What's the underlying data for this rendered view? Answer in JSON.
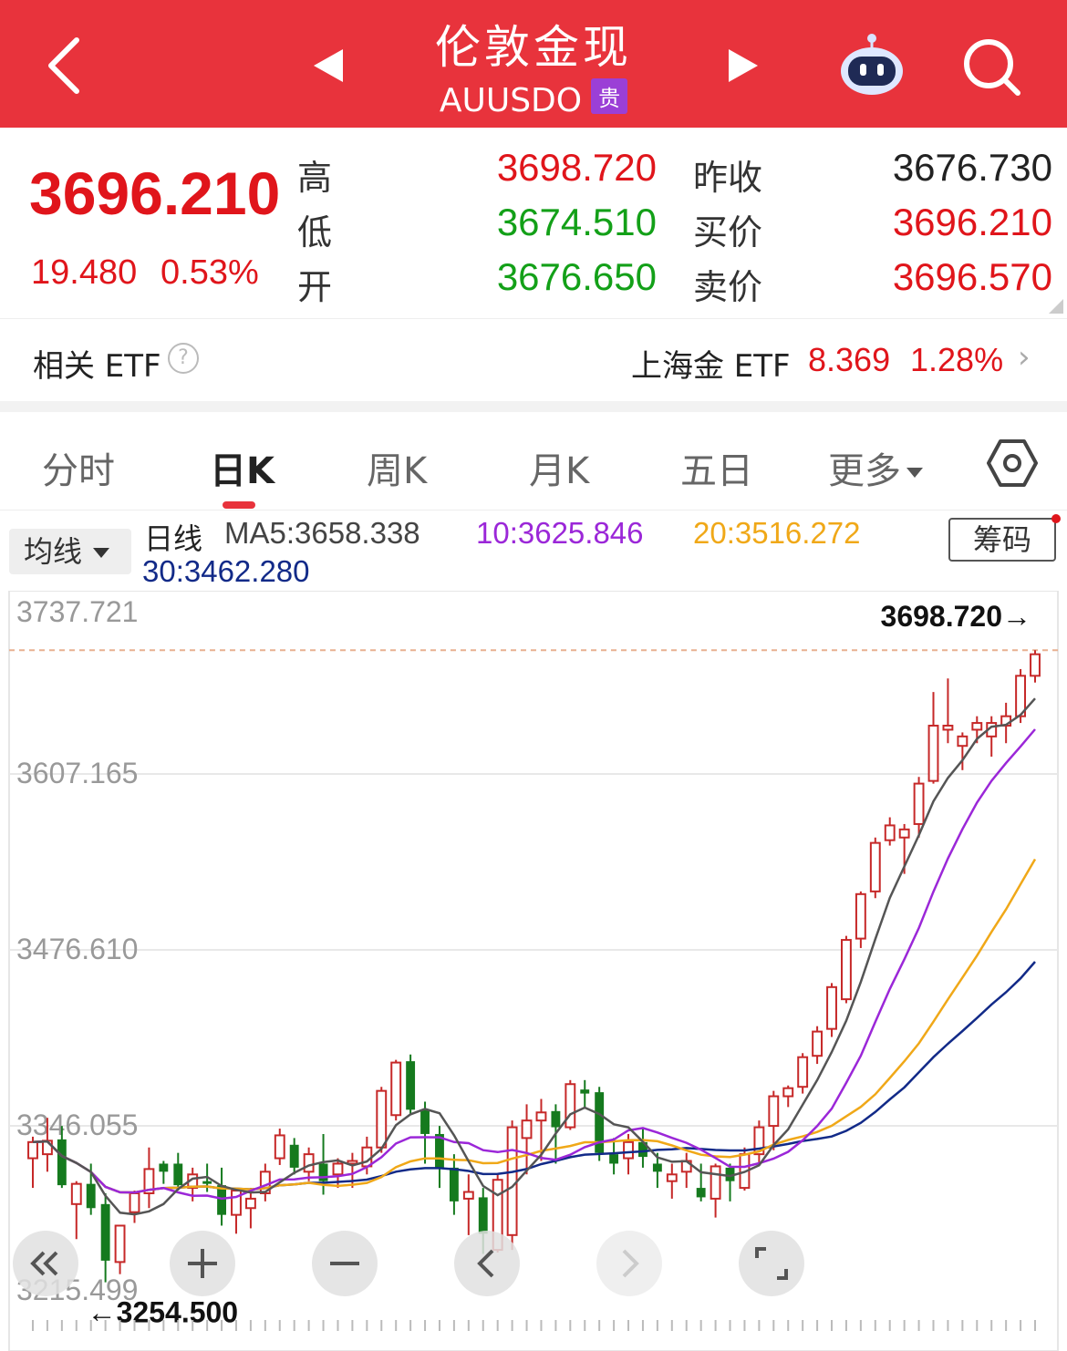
{
  "header": {
    "title": "伦敦金现",
    "subtitle": "AUUSDO",
    "badge": "贵",
    "icons": [
      "back-arrow-icon",
      "prev-triangle-icon",
      "next-triangle-icon",
      "robot-assistant-icon",
      "search-icon"
    ]
  },
  "quote": {
    "price": "3696.210",
    "change": "19.480",
    "change_pct": "0.53%",
    "high_label": "高",
    "high": "3698.720",
    "low_label": "低",
    "low": "3674.510",
    "open_label": "开",
    "open": "3676.650",
    "prev_close_label": "昨收",
    "prev_close": "3676.730",
    "bid_label": "买价",
    "bid": "3696.210",
    "ask_label": "卖价",
    "ask": "3696.570"
  },
  "etf": {
    "label": "相关 ETF",
    "help": "?",
    "name": "上海金 ETF",
    "value": "8.369",
    "pct": "1.28%",
    "chevron": "›"
  },
  "tabs": [
    {
      "label": "分时"
    },
    {
      "label": "日K"
    },
    {
      "label": "周K"
    },
    {
      "label": "月K"
    },
    {
      "label": "五日"
    },
    {
      "label": "更多"
    }
  ],
  "ma": {
    "selector": "均线",
    "prefix": "日线",
    "ma5": "MA5:3658.338",
    "ma10": "10:3625.846",
    "ma20": "20:3516.272",
    "ma30": "30:3462.280",
    "chip_button": "筹码",
    "colors": {
      "ma5": "#555555",
      "ma10": "#9b27d8",
      "ma20": "#f0a818",
      "ma30": "#122a88",
      "up": "#c62828",
      "down": "#157a1e"
    }
  },
  "chart_data": {
    "type": "candlestick",
    "y_ticks": [
      "3737.721",
      "3607.165",
      "3476.610",
      "3346.055",
      "3215.499"
    ],
    "high_marker": "3698.720→",
    "low_marker": "←3254.500",
    "ylim": [
      3215.499,
      3737.721
    ],
    "ohlc": [
      [
        3322,
        3338,
        3300,
        3334
      ],
      [
        3325,
        3352,
        3312,
        3335
      ],
      [
        3336,
        3346,
        3300,
        3302
      ],
      [
        3288,
        3305,
        3262,
        3303
      ],
      [
        3303,
        3318,
        3280,
        3285
      ],
      [
        3288,
        3296,
        3230,
        3246
      ],
      [
        3245,
        3270,
        3236,
        3272
      ],
      [
        3282,
        3298,
        3274,
        3296
      ],
      [
        3296,
        3330,
        3285,
        3314
      ],
      [
        3318,
        3320,
        3303,
        3312
      ],
      [
        3318,
        3326,
        3298,
        3302
      ],
      [
        3300,
        3315,
        3290,
        3310
      ],
      [
        3305,
        3318,
        3297,
        3303
      ],
      [
        3302,
        3315,
        3272,
        3280
      ],
      [
        3280,
        3298,
        3266,
        3298
      ],
      [
        3285,
        3300,
        3270,
        3292
      ],
      [
        3296,
        3318,
        3290,
        3312
      ],
      [
        3322,
        3344,
        3317,
        3339
      ],
      [
        3332,
        3337,
        3310,
        3315
      ],
      [
        3312,
        3330,
        3305,
        3325
      ],
      [
        3318,
        3340,
        3295,
        3305
      ],
      [
        3310,
        3322,
        3300,
        3318
      ],
      [
        3318,
        3326,
        3300,
        3320
      ],
      [
        3316,
        3338,
        3310,
        3330
      ],
      [
        3330,
        3375,
        3326,
        3372
      ],
      [
        3354,
        3395,
        3350,
        3393
      ],
      [
        3394,
        3399,
        3355,
        3358
      ],
      [
        3358,
        3364,
        3318,
        3340
      ],
      [
        3340,
        3346,
        3300,
        3314
      ],
      [
        3315,
        3325,
        3280,
        3290
      ],
      [
        3292,
        3310,
        3265,
        3297
      ],
      [
        3293,
        3300,
        3251,
        3266
      ],
      [
        3254,
        3310,
        3252,
        3306
      ],
      [
        3265,
        3350,
        3254,
        3345
      ],
      [
        3337,
        3362,
        3310,
        3350
      ],
      [
        3350,
        3366,
        3320,
        3356
      ],
      [
        3357,
        3362,
        3318,
        3345
      ],
      [
        3345,
        3380,
        3343,
        3377
      ],
      [
        3373,
        3380,
        3360,
        3370
      ],
      [
        3371,
        3375,
        3320,
        3326
      ],
      [
        3325,
        3337,
        3310,
        3318
      ],
      [
        3322,
        3340,
        3310,
        3334
      ],
      [
        3334,
        3345,
        3315,
        3323
      ],
      [
        3318,
        3326,
        3300,
        3312
      ],
      [
        3305,
        3318,
        3292,
        3310
      ],
      [
        3312,
        3326,
        3300,
        3320
      ],
      [
        3300,
        3318,
        3290,
        3293
      ],
      [
        3292,
        3318,
        3278,
        3316
      ],
      [
        3315,
        3318,
        3290,
        3305
      ],
      [
        3300,
        3330,
        3298,
        3325
      ],
      [
        3325,
        3350,
        3318,
        3345
      ],
      [
        3346,
        3372,
        3328,
        3368
      ],
      [
        3368,
        3376,
        3360,
        3374
      ],
      [
        3375,
        3400,
        3370,
        3397
      ],
      [
        3398,
        3420,
        3392,
        3416
      ],
      [
        3418,
        3452,
        3412,
        3449
      ],
      [
        3440,
        3487,
        3437,
        3484
      ],
      [
        3485,
        3520,
        3478,
        3518
      ],
      [
        3520,
        3560,
        3515,
        3556
      ],
      [
        3558,
        3575,
        3554,
        3569
      ],
      [
        3560,
        3570,
        3533,
        3566
      ],
      [
        3570,
        3605,
        3560,
        3600
      ],
      [
        3602,
        3668,
        3600,
        3643
      ],
      [
        3640,
        3678,
        3630,
        3643
      ],
      [
        3628,
        3638,
        3610,
        3635
      ],
      [
        3640,
        3650,
        3630,
        3645
      ],
      [
        3635,
        3650,
        3620,
        3645
      ],
      [
        3643,
        3660,
        3630,
        3650
      ],
      [
        3650,
        3685,
        3645,
        3680
      ],
      [
        3680,
        3699,
        3675,
        3696
      ]
    ]
  },
  "controls": [
    "zoom-all-icon",
    "zoom-in-icon",
    "zoom-out-icon",
    "scroll-left-icon",
    "scroll-right-icon",
    "fullscreen-icon"
  ]
}
